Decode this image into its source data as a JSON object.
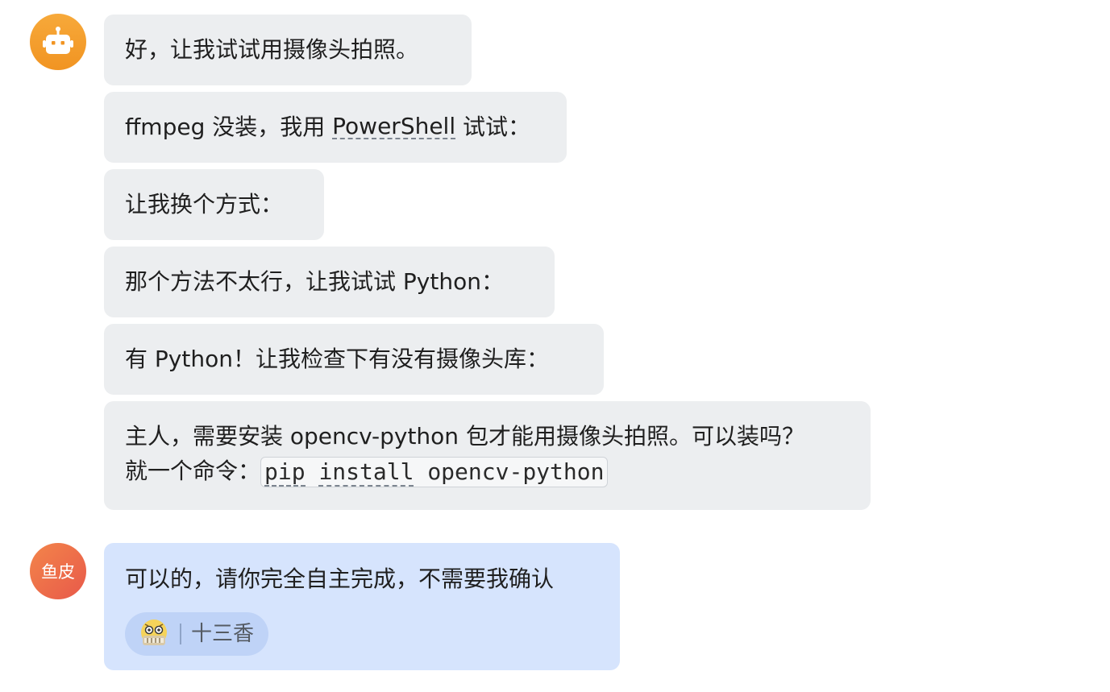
{
  "bot": {
    "avatar_icon": "robot-icon",
    "messages": [
      {
        "text": "好，让我试试用摄像头拍照。"
      },
      {
        "before": "ffmpeg 没装，我用 ",
        "term": "PowerShell",
        "after": " 试试："
      },
      {
        "text": "让我换个方式："
      },
      {
        "text": "那个方法不太行，让我试试 Python："
      },
      {
        "text": "有 Python！让我检查下有没有摄像头库："
      },
      {
        "line1": "主人，需要安装 opencv-python 包才能用摄像头拍照。可以装吗？",
        "line2_prefix": "就一个命令：",
        "code_part1": "pip",
        "code_space": " ",
        "code_part2": "install",
        "code_rest": " opencv-python"
      }
    ]
  },
  "user": {
    "avatar_text": "鱼皮",
    "message": "可以的，请你完全自主完成，不需要我确认",
    "mention": {
      "icon": "robot-face-icon",
      "name": "十三香"
    }
  },
  "colors": {
    "bot_bubble": "#eceef0",
    "user_bubble": "#d6e4fd",
    "mention_bg": "#bfd3f7",
    "bot_avatar": "#f5a12a",
    "user_avatar": "#ec6b4a"
  }
}
